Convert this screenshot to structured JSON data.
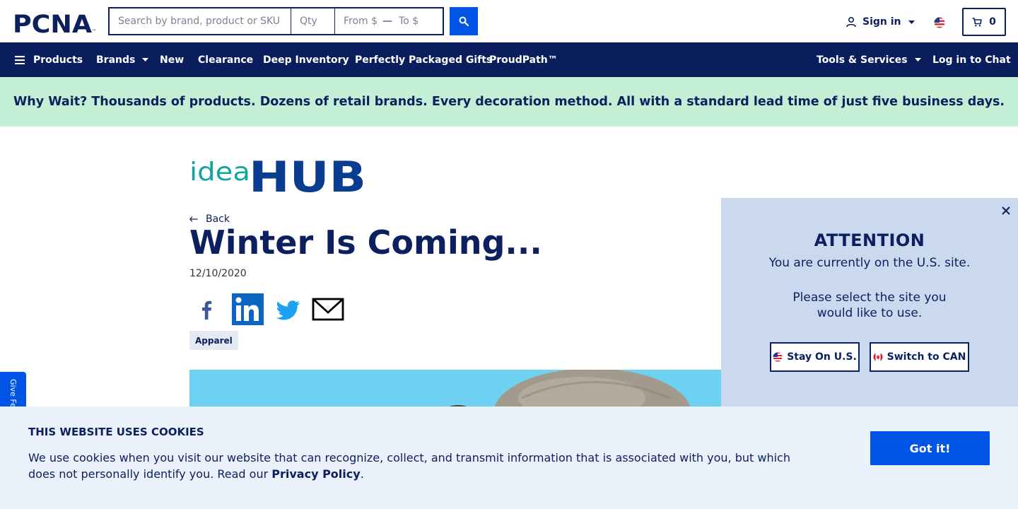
{
  "header": {
    "logo_text": "PCNA",
    "search": {
      "main_placeholder": "Search by brand, product or SKU",
      "qty_placeholder": "Qty",
      "from_placeholder": "From $",
      "range_separator": "—",
      "to_placeholder": "To $"
    },
    "sign_in_label": "Sign in",
    "cart_count": "0"
  },
  "nav": {
    "left": [
      "Products",
      "Brands",
      "New",
      "Clearance",
      "Deep Inventory",
      "Perfectly Packaged Gifts",
      "ProudPath™"
    ],
    "right": [
      "Tools & Services",
      "Log in to Chat"
    ]
  },
  "banner": {
    "text": "Why Wait? Thousands of products. Dozens of retail brands. Every decoration method. All with a standard lead time of just five business days."
  },
  "article": {
    "logo_text_light": "idea",
    "logo_text_bold": "HUB",
    "back_label": "Back",
    "title": "Winter Is Coming...",
    "date": "12/10/2020",
    "share": [
      "facebook-icon",
      "linkedin-icon",
      "twitter-icon",
      "email-icon"
    ],
    "tag": "Apparel"
  },
  "feedback_tab": "Give Feedback",
  "attention": {
    "title": "ATTENTION",
    "line1": "You are currently on the U.S. site.",
    "line2": "Please select the site you",
    "line3": "would like to use.",
    "stay_label": "Stay On U.S.",
    "switch_label": "Switch to CAN"
  },
  "cookies": {
    "title": "THIS WEBSITE USES COOKIES",
    "text_before": "We use cookies when you visit our website that can recognize, collect, and transmit information that is associated with you, but which does not personally identify you. Read our ",
    "link": "Privacy Policy",
    "text_after": ".",
    "button": "Got it!"
  },
  "colors": {
    "navy": "#0a1d5c",
    "accent_blue": "#0055e6",
    "banner_green": "#c3efd5",
    "teal": "#10a5a0",
    "panel_blue": "#cbd9ee",
    "cookie_bg": "#eaf1fb"
  }
}
